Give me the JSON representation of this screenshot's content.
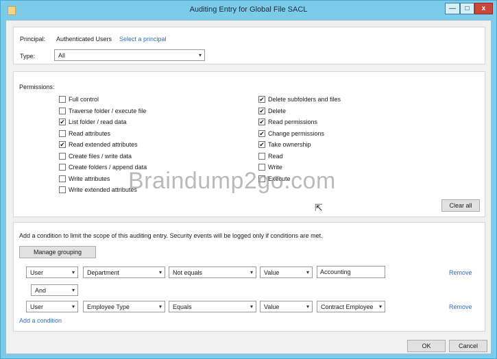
{
  "window": {
    "title": "Auditing Entry for Global File SACL",
    "min_symbol": "—",
    "max_symbol": "□",
    "close_symbol": "x"
  },
  "principal": {
    "label": "Principal:",
    "value": "Authenticated Users",
    "select_link": "Select a principal"
  },
  "type": {
    "label": "Type:",
    "value": "All"
  },
  "permissions": {
    "heading": "Permissions:",
    "left": [
      {
        "label": "Full control",
        "checked": false
      },
      {
        "label": "Traverse folder / execute file",
        "checked": false
      },
      {
        "label": "List folder / read data",
        "checked": true
      },
      {
        "label": "Read attributes",
        "checked": false
      },
      {
        "label": "Read extended attributes",
        "checked": true
      },
      {
        "label": "Create files / write data",
        "checked": false
      },
      {
        "label": "Create folders / append data",
        "checked": false
      },
      {
        "label": "Write attributes",
        "checked": false
      },
      {
        "label": "Write extended attributes",
        "checked": false
      }
    ],
    "right": [
      {
        "label": "Delete subfolders and files",
        "checked": true
      },
      {
        "label": "Delete",
        "checked": true
      },
      {
        "label": "Read permissions",
        "checked": true
      },
      {
        "label": "Change permissions",
        "checked": true
      },
      {
        "label": "Take ownership",
        "checked": true
      },
      {
        "label": "Read",
        "checked": false
      },
      {
        "label": "Write",
        "checked": false
      },
      {
        "label": "Execute",
        "checked": false
      }
    ],
    "clear_all": "Clear all"
  },
  "conditions": {
    "description": "Add a condition to limit the scope of this auditing entry. Security events will be logged only if conditions are met.",
    "manage_grouping": "Manage grouping",
    "rows": [
      {
        "subject": "User",
        "attribute": "Department",
        "operator": "Not equals",
        "value_type": "Value",
        "value": "Accounting",
        "remove": "Remove"
      },
      {
        "subject": "User",
        "attribute": "Employee Type",
        "operator": "Equals",
        "value_type": "Value",
        "value": "Contract Employee",
        "remove": "Remove"
      }
    ],
    "connector": "And",
    "add_condition": "Add a condition"
  },
  "footer": {
    "ok": "OK",
    "cancel": "Cancel"
  },
  "watermark": "Braindump2go.com",
  "icons": {
    "dropdown": "▾",
    "check": "✔",
    "cursor": "⇱"
  }
}
